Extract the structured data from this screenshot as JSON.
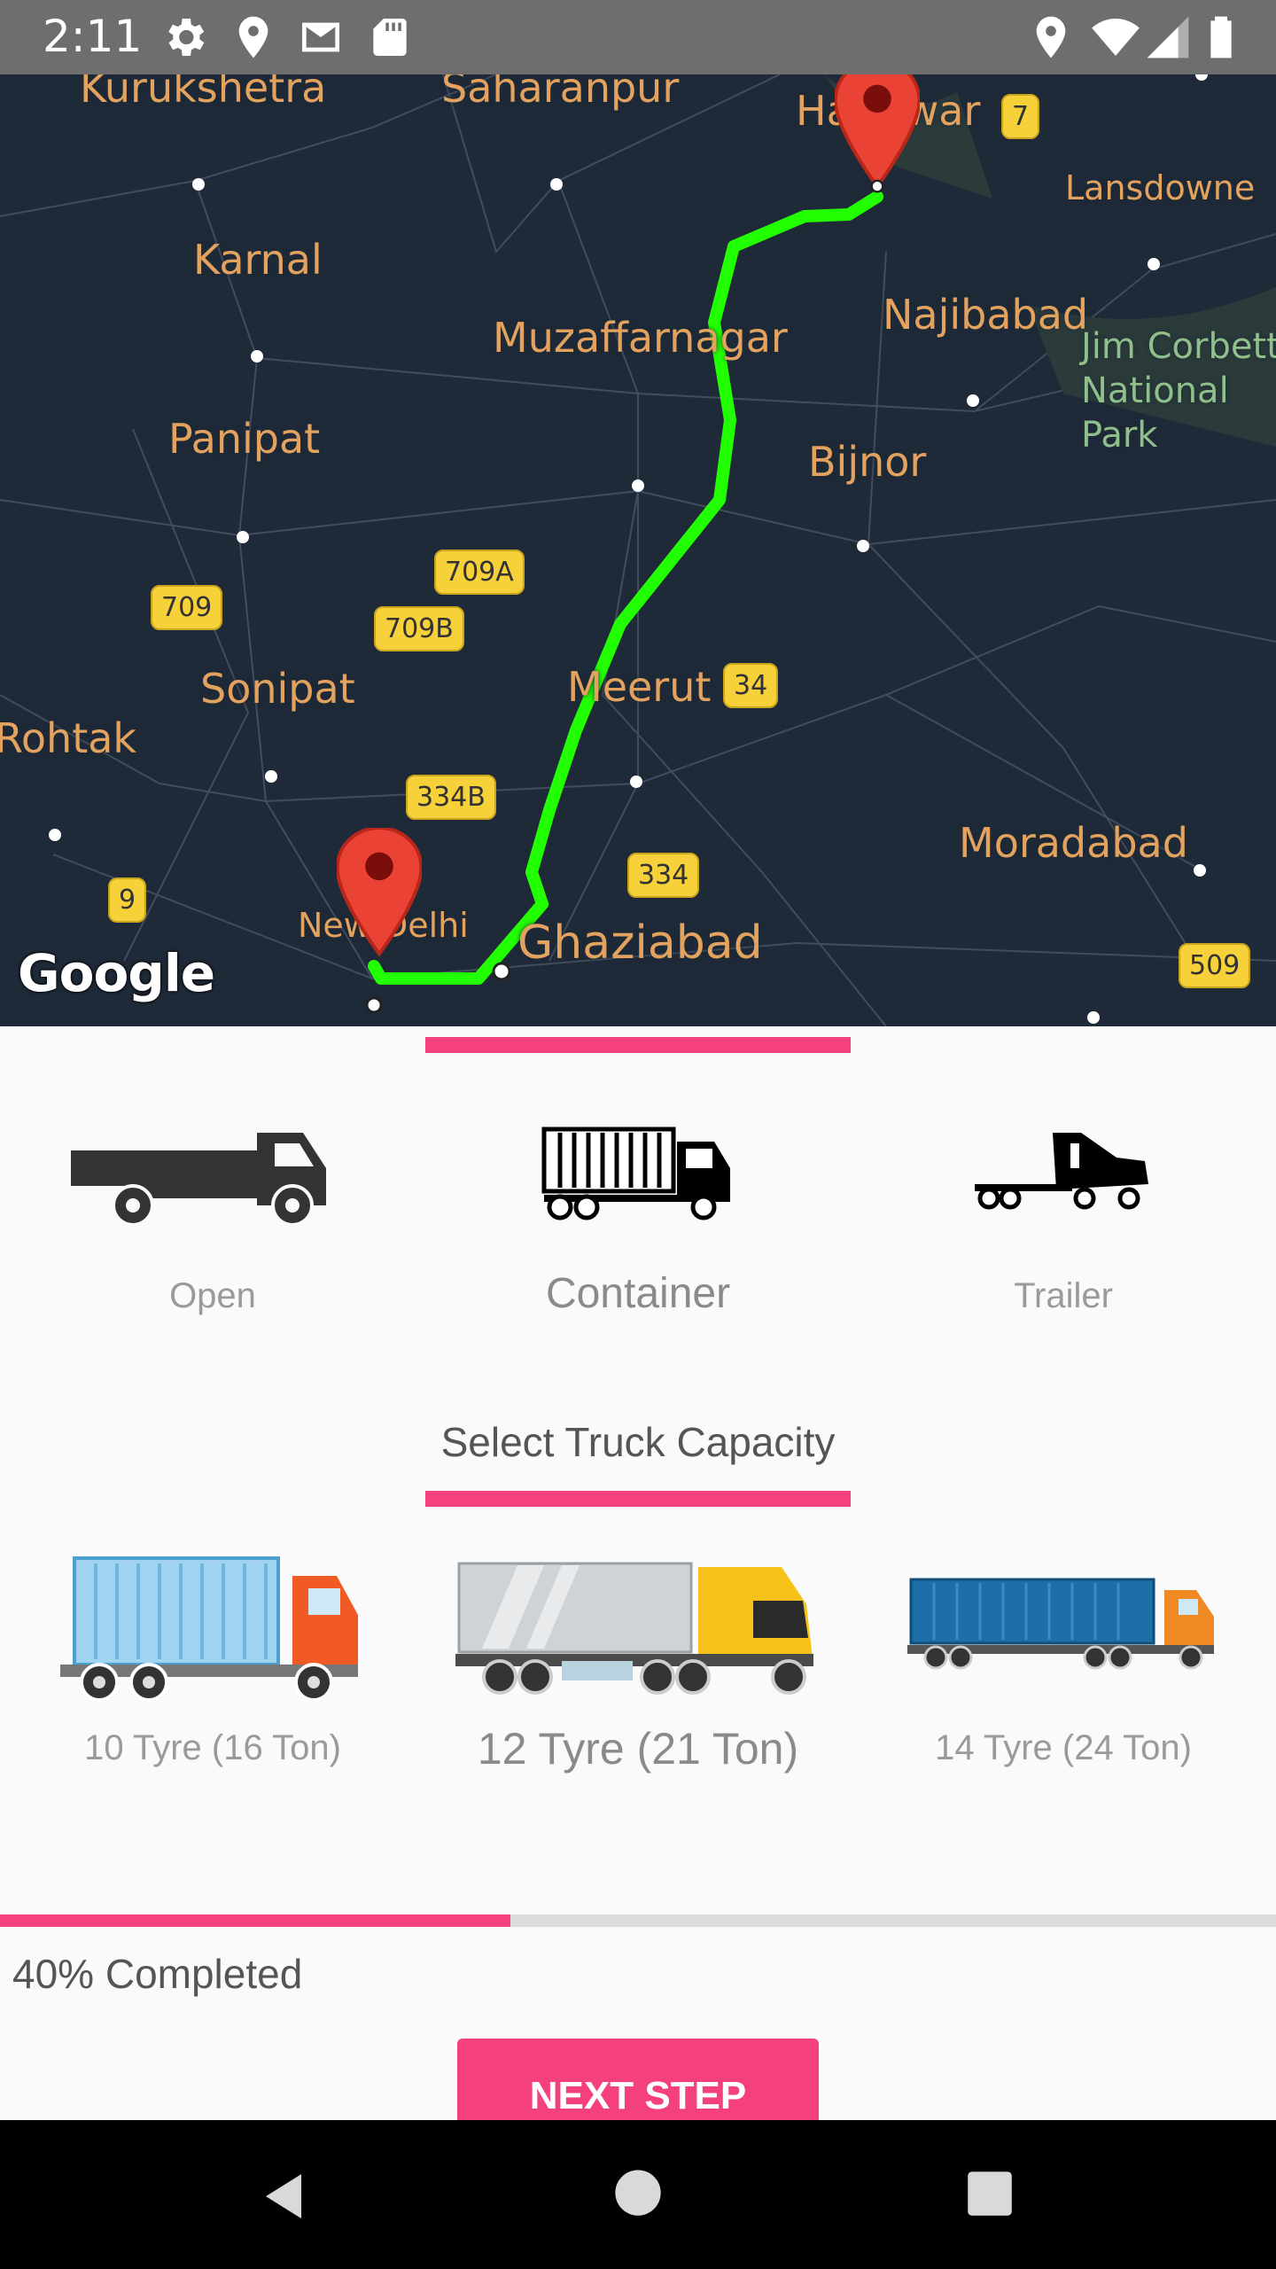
{
  "status_bar": {
    "time": "2:11",
    "left_icons": [
      "gear-icon",
      "location-icon",
      "gmail-icon",
      "sd-card-icon"
    ],
    "right_icons": [
      "location-icon",
      "wifi-icon",
      "signal-icon",
      "battery-icon"
    ]
  },
  "map": {
    "attribution": "Google",
    "cities": [
      {
        "name": "Kurukshetra"
      },
      {
        "name": "Saharanpur"
      },
      {
        "name": "Haridwar"
      },
      {
        "name": "Lansdowne"
      },
      {
        "name": "Karnal"
      },
      {
        "name": "Muzaffarnagar"
      },
      {
        "name": "Najibabad"
      },
      {
        "name": "Jim Corbett National Park"
      },
      {
        "name": "Panipat"
      },
      {
        "name": "Bijnor"
      },
      {
        "name": "Sonipat"
      },
      {
        "name": "Meerut"
      },
      {
        "name": "Rohtak"
      },
      {
        "name": "Moradabad"
      },
      {
        "name": "New Delhi"
      },
      {
        "name": "Ghaziabad"
      }
    ],
    "road_shields": [
      "7",
      "709A",
      "709",
      "709B",
      "34",
      "334B",
      "334",
      "9",
      "509"
    ],
    "route_color": "#22ff00",
    "marker_color": "#ea4335"
  },
  "truck_types": {
    "items": [
      {
        "label": "Open",
        "icon": "open-truck-icon",
        "selected": false
      },
      {
        "label": "Container",
        "icon": "container-truck-icon",
        "selected": true
      },
      {
        "label": "Trailer",
        "icon": "trailer-truck-icon",
        "selected": false
      }
    ]
  },
  "capacity": {
    "title": "Select Truck Capacity",
    "items": [
      {
        "label": "10 Tyre (16 Ton)",
        "selected": false
      },
      {
        "label": "12 Tyre (21 Ton)",
        "selected": true
      },
      {
        "label": "14 Tyre (24 Ton)",
        "selected": false
      }
    ]
  },
  "progress": {
    "percent": 40,
    "text": "40% Completed"
  },
  "next_button": {
    "label": "NEXT STEP"
  },
  "nav": {
    "icons": [
      "back-icon",
      "home-icon",
      "recents-icon"
    ]
  },
  "colors": {
    "accent": "#f4417d",
    "map_bg": "#1f2a38",
    "city_label": "#e3a35f"
  }
}
